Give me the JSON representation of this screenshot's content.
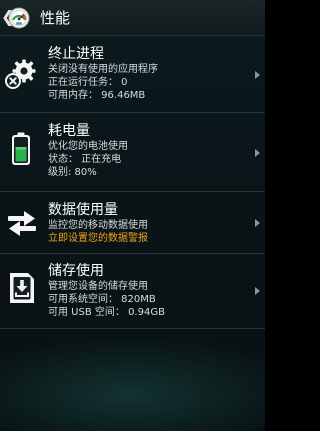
{
  "header": {
    "back_glyph": "❮",
    "title": "性能",
    "app_icon": "speedometer-icon"
  },
  "rows": [
    {
      "icon": "gear-close-icon",
      "title": "终止进程",
      "lines": [
        "关闭没有使用的应用程序",
        "正在运行任务： 0",
        "可用内存： 96.46MB"
      ]
    },
    {
      "icon": "battery-icon",
      "title": "耗电量",
      "lines": [
        "优化您的电池使用",
        "状态： 正在充电",
        "级别: 80%"
      ]
    },
    {
      "icon": "data-transfer-icon",
      "title": "数据使用量",
      "lines": [
        "监控您的移动数据使用",
        "立即设置您的数据警报"
      ]
    },
    {
      "icon": "storage-download-icon",
      "title": "储存使用",
      "lines": [
        "管理您设备的储存使用",
        "可用系统空间： 820MB",
        "可用 USB 空间： 0.94GB"
      ]
    }
  ],
  "colors": {
    "accent_warning": "#f0a21a",
    "text_primary": "#ffffff",
    "divider": "#2b3537"
  }
}
